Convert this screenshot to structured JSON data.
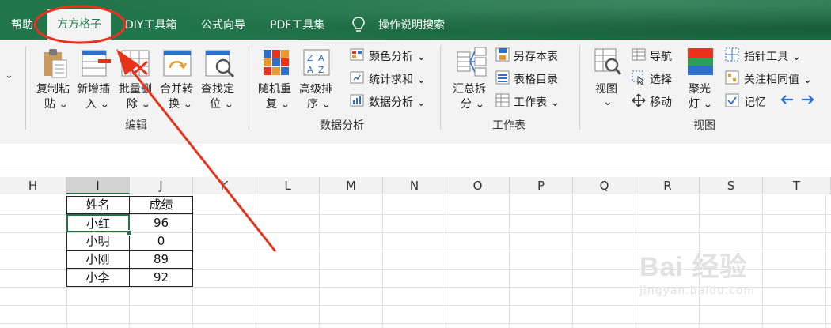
{
  "menu": {
    "tabs": [
      "帮助",
      "方方格子",
      "DIY工具箱",
      "公式向导",
      "PDF工具集",
      "操作说明搜索"
    ],
    "active_tab": "方方格子"
  },
  "ribbon": {
    "left_chevron": "⌄",
    "edit_group": {
      "label": "编辑",
      "buttons": [
        {
          "line1": "复制粘",
          "line2": "贴 ⌄"
        },
        {
          "line1": "新增插",
          "line2": "入 ⌄"
        },
        {
          "line1": "批量删",
          "line2": "除 ⌄"
        },
        {
          "line1": "合并转",
          "line2": "换 ⌄"
        },
        {
          "line1": "查找定",
          "line2": "位 ⌄"
        }
      ]
    },
    "data_group": {
      "label": "数据分析",
      "buttons": [
        {
          "line1": "随机重",
          "line2": "复 ⌄"
        },
        {
          "line1": "高级排",
          "line2": "序 ⌄"
        }
      ],
      "small_items": [
        "颜色分析 ⌄",
        "统计求和 ⌄",
        "数据分析 ⌄"
      ]
    },
    "sheet_group": {
      "label": "工作表",
      "big_button": {
        "line1": "汇总拆",
        "line2": "分 ⌄"
      },
      "small_items": [
        "另存本表",
        "表格目录",
        "工作表 ⌄"
      ]
    },
    "view_group": {
      "label": "视图",
      "view_button": {
        "line1": "视图",
        "line2": "⌄"
      },
      "small_items": [
        "导航",
        "选择",
        "移动"
      ],
      "spotlight": {
        "line1": "聚光",
        "line2": "灯 ⌄"
      },
      "right_items": [
        "指针工具 ⌄",
        "关注相同值 ⌄",
        "记忆"
      ]
    }
  },
  "sheet": {
    "columns": [
      "H",
      "I",
      "J",
      "K",
      "L",
      "M",
      "N",
      "O",
      "P",
      "Q",
      "R",
      "S",
      "T"
    ],
    "selected_column": "I",
    "table": {
      "headers": [
        "姓名",
        "成绩"
      ],
      "rows": [
        [
          "小红",
          "96"
        ],
        [
          "小明",
          "0"
        ],
        [
          "小刚",
          "89"
        ],
        [
          "小李",
          "92"
        ]
      ]
    }
  },
  "colors": {
    "menu_bg": "#21754a",
    "annotation": "#e8321c",
    "accent_blue": "#2f6fc9"
  },
  "watermark": {
    "brand": "Bai 经验",
    "url": "jingyan.baidu.com"
  }
}
